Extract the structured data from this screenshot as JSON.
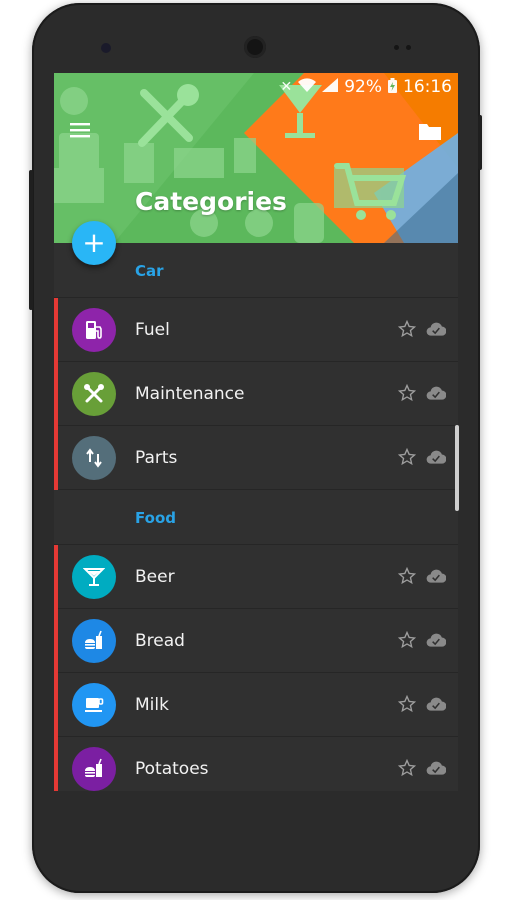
{
  "status_bar": {
    "battery": "92%",
    "time": "16:16"
  },
  "header": {
    "title": "Categories"
  },
  "fab": {
    "symbol": "+"
  },
  "colors": {
    "header_green": "#5cb85c",
    "accent_blue": "#29a3e6",
    "fab_blue": "#29b6f6",
    "row_stripe_red": "#e53935",
    "background_dark": "#303030"
  },
  "sections": [
    {
      "title": "Car",
      "items": [
        {
          "label": "Fuel",
          "icon": "fuel-pump-icon",
          "color": "#8e24aa"
        },
        {
          "label": "Maintenance",
          "icon": "tools-icon",
          "color": "#689f38"
        },
        {
          "label": "Parts",
          "icon": "swap-vertical-icon",
          "color": "#546e7a"
        }
      ]
    },
    {
      "title": "Food",
      "items": [
        {
          "label": "Beer",
          "icon": "cocktail-glass-icon",
          "color": "#00acc1"
        },
        {
          "label": "Bread",
          "icon": "fastfood-icon",
          "color": "#1e88e5"
        },
        {
          "label": "Milk",
          "icon": "coffee-cup-icon",
          "color": "#2196f3"
        },
        {
          "label": "Potatoes",
          "icon": "fastfood-icon",
          "color": "#7b1fa2"
        }
      ]
    }
  ]
}
